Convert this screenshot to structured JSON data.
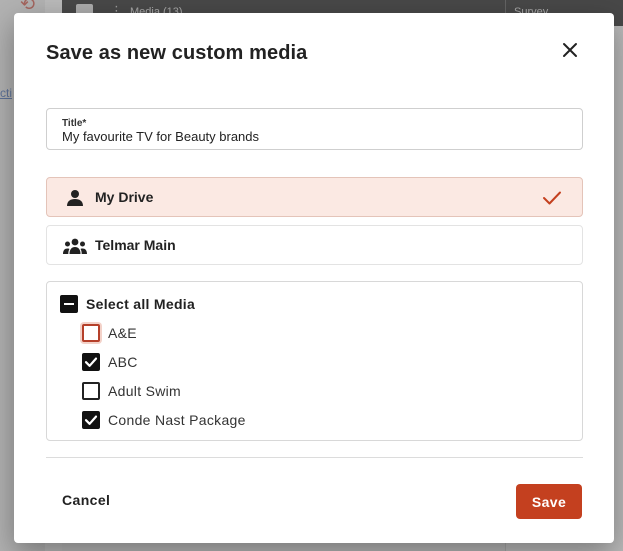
{
  "background": {
    "media_tab": "Media (13)",
    "survey_tab": "Survey",
    "side_link": "cti"
  },
  "dialog": {
    "title": "Save as new custom media",
    "title_field": {
      "label": "Title*",
      "value": "My favourite TV for Beauty brands"
    },
    "drives": [
      {
        "label": "My Drive",
        "selected": true,
        "icon": "person-icon"
      },
      {
        "label": "Telmar Main",
        "selected": false,
        "icon": "group-icon"
      }
    ],
    "select_all": {
      "label": "Select all Media",
      "state": "indeterminate"
    },
    "media": [
      {
        "label": "A&E",
        "checked": false
      },
      {
        "label": "ABC",
        "checked": true
      },
      {
        "label": "Adult Swim",
        "checked": false
      },
      {
        "label": "Conde Nast Package",
        "checked": true
      }
    ],
    "cancel_label": "Cancel",
    "save_label": "Save"
  },
  "colors": {
    "accent": "#c4401f",
    "selected_bg": "#fbe9e3"
  }
}
